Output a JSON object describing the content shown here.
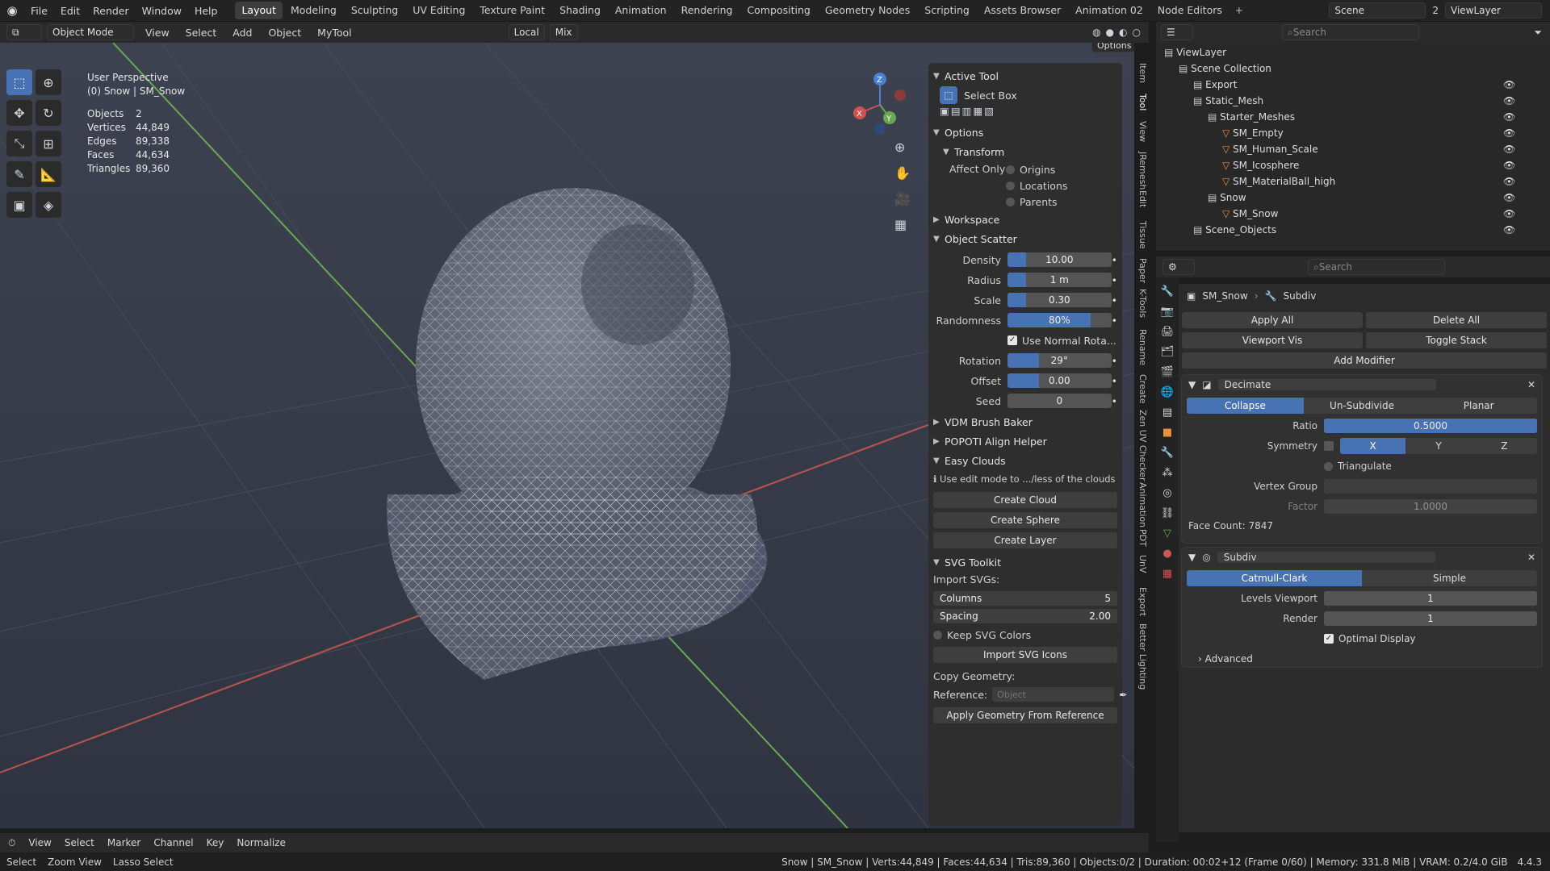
{
  "topbar": {
    "menus": [
      "File",
      "Edit",
      "Render",
      "Window",
      "Help"
    ],
    "workspaces": [
      "Layout",
      "Modeling",
      "Sculpting",
      "UV Editing",
      "Texture Paint",
      "Shading",
      "Animation",
      "Rendering",
      "Compositing",
      "Geometry Nodes",
      "Scripting",
      "Assets Browser",
      "Animation 02",
      "Node Editors"
    ],
    "active_workspace": "Layout",
    "scene": "Scene",
    "scene_count": "2",
    "viewlayer": "ViewLayer"
  },
  "viewport_header": {
    "mode": "Object Mode",
    "menus": [
      "View",
      "Select",
      "Add",
      "Object",
      "MyTool"
    ],
    "orientation": "Local",
    "pivot": "Mix",
    "options": "Options"
  },
  "overlay": {
    "view_name": "User Perspective",
    "object_path": "(0) Snow | SM_Snow",
    "stats": [
      {
        "k": "Objects",
        "v": "2"
      },
      {
        "k": "Vertices",
        "v": "44,849"
      },
      {
        "k": "Edges",
        "v": "89,338"
      },
      {
        "k": "Faces",
        "v": "44,634"
      },
      {
        "k": "Triangles",
        "v": "89,360"
      }
    ]
  },
  "gizmo": {
    "x": "X",
    "y": "Y",
    "z": "Z"
  },
  "npanel": {
    "active_tool": "Active Tool",
    "select_box": "Select Box",
    "options": "Options",
    "transform": "Transform",
    "affect_only": "Affect Only",
    "affect_items": [
      "Origins",
      "Locations",
      "Parents"
    ],
    "workspace": "Workspace",
    "object_scatter": "Object Scatter",
    "scatter": [
      {
        "label": "Density",
        "value": "10.00",
        "fill": 0.18
      },
      {
        "label": "Radius",
        "value": "1 m",
        "fill": 0.18
      },
      {
        "label": "Scale",
        "value": "0.30",
        "fill": 0.18
      },
      {
        "label": "Randomness",
        "value": "80%",
        "fill": 0.8
      }
    ],
    "use_normal": "Use Normal Rota...",
    "scatter2": [
      {
        "label": "Rotation",
        "value": "29°",
        "fill": 0.3
      },
      {
        "label": "Offset",
        "value": "0.00",
        "fill": 0.3
      },
      {
        "label": "Seed",
        "value": "0",
        "fill": 0
      }
    ],
    "vdm": "VDM Brush Baker",
    "popoti": "POPOTI Align Helper",
    "easy_clouds": "Easy Clouds",
    "clouds_hint": "Use edit mode to .../less of the clouds",
    "cloud_buttons": [
      "Create Cloud",
      "Create Sphere",
      "Create Layer"
    ],
    "svg_toolkit": "SVG Toolkit",
    "import_svgs": "Import SVGs:",
    "columns_label": "Columns",
    "columns_value": "5",
    "spacing_label": "Spacing",
    "spacing_value": "2.00",
    "keep_colors": "Keep SVG Colors",
    "import_icons": "Import SVG Icons",
    "copy_geometry": "Copy Geometry:",
    "reference_label": "Reference:",
    "reference_placeholder": "Object",
    "apply_geometry": "Apply Geometry From Reference"
  },
  "vtabs": [
    "Item",
    "Tool",
    "View",
    "JRemesh",
    "Edit",
    "Tissue",
    "Paper",
    "K-Tools",
    "Rename",
    "Create",
    "Zen UV Checker",
    "Animation",
    "PDT",
    "UnV",
    "Export",
    "Better Lighting"
  ],
  "timeline": {
    "menus": [
      "View",
      "Select",
      "Marker",
      "Channel",
      "Key"
    ],
    "normalize": "Normalize"
  },
  "statusbar": {
    "left": [
      "Select",
      "Zoom View",
      "Lasso Select"
    ],
    "info": "Snow | SM_Snow | Verts:44,849 | Faces:44,634 | Tris:89,360 | Objects:0/2 | Duration: 00:02+12 (Frame 0/60) | Memory: 331.8 MiB | VRAM: 0.2/4.0 GiB",
    "version": "4.4.3"
  },
  "outliner": {
    "search_placeholder": "Search",
    "rows": [
      {
        "label": "ViewLayer",
        "indent": 0
      },
      {
        "label": "Scene Collection",
        "indent": 1
      },
      {
        "label": "Export",
        "indent": 2
      },
      {
        "label": "Static_Mesh",
        "indent": 2
      },
      {
        "label": "Starter_Meshes",
        "indent": 3
      },
      {
        "label": "SM_Empty",
        "indent": 4
      },
      {
        "label": "SM_Human_Scale",
        "indent": 4
      },
      {
        "label": "SM_Icosphere",
        "indent": 4
      },
      {
        "label": "SM_MaterialBall_high",
        "indent": 4
      },
      {
        "label": "Snow",
        "indent": 3
      },
      {
        "label": "SM_Snow",
        "indent": 4
      },
      {
        "label": "Scene_Objects",
        "indent": 2
      }
    ]
  },
  "properties": {
    "search_placeholder": "Search",
    "object": "SM_Snow",
    "modifier_crumb": "Subdiv",
    "apply_all": "Apply All",
    "delete_all": "Delete All",
    "viewport_vis": "Viewport Vis",
    "toggle_stack": "Toggle Stack",
    "add_modifier": "Add Modifier",
    "decimate": {
      "name": "Decimate",
      "tabs": [
        "Collapse",
        "Un-Subdivide",
        "Planar"
      ],
      "ratio_label": "Ratio",
      "ratio": "0.5000",
      "symmetry_label": "Symmetry",
      "axes": [
        "X",
        "Y",
        "Z"
      ],
      "triangulate": "Triangulate",
      "vgroup_label": "Vertex Group",
      "factor_label": "Factor",
      "factor": "1.0000",
      "face_count": "Face Count: 7847"
    },
    "subdiv": {
      "name": "Subdiv",
      "tabs": [
        "Catmull-Clark",
        "Simple"
      ],
      "levels_label": "Levels Viewport",
      "levels": "1",
      "render_label": "Render",
      "render": "1",
      "optimal": "Optimal Display",
      "advanced": "Advanced"
    }
  }
}
